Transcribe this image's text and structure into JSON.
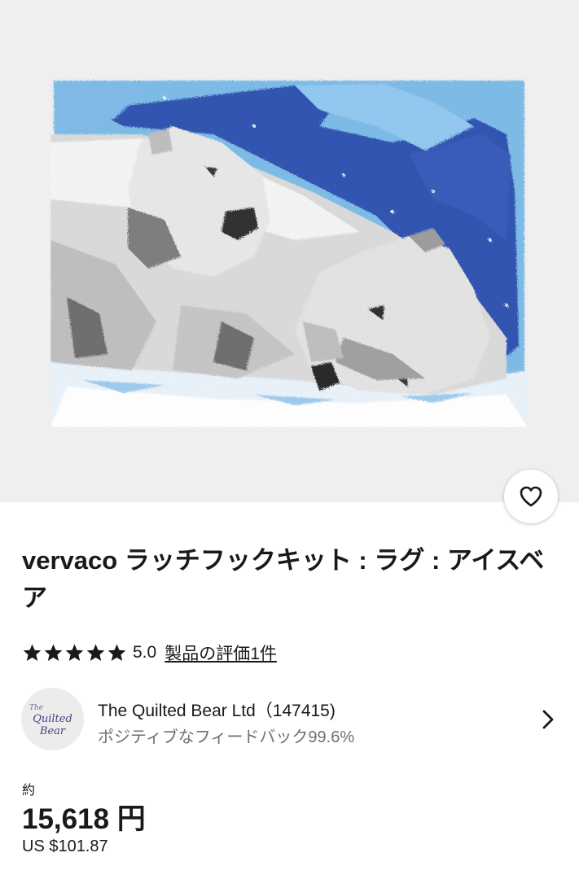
{
  "product": {
    "image_alt": "Latch hook rug with two polar bears on a blue and white background",
    "title": "vervaco ラッチフックキット : ラグ : アイスベア",
    "favorite_icon": "heart-outline-icon"
  },
  "rating": {
    "stars": 5,
    "value": "5.0",
    "reviews_link": "製品の評価1件"
  },
  "seller": {
    "logo_top": "The",
    "logo_text": "Quilted Bear",
    "name": "The Quilted Bear Ltd（147415)",
    "feedback": "ポジティブなフィードバック99.6%",
    "chevron_icon": "chevron-right-icon"
  },
  "price": {
    "approx_label": "約",
    "jpy": "15,618 円",
    "usd": "US $101.87"
  },
  "colors": {
    "hero_background": "#efefef",
    "text": "#191919",
    "secondary_text": "#707070",
    "rug_dark_blue": "#2a4fae",
    "rug_light_blue": "#79b9e6"
  }
}
